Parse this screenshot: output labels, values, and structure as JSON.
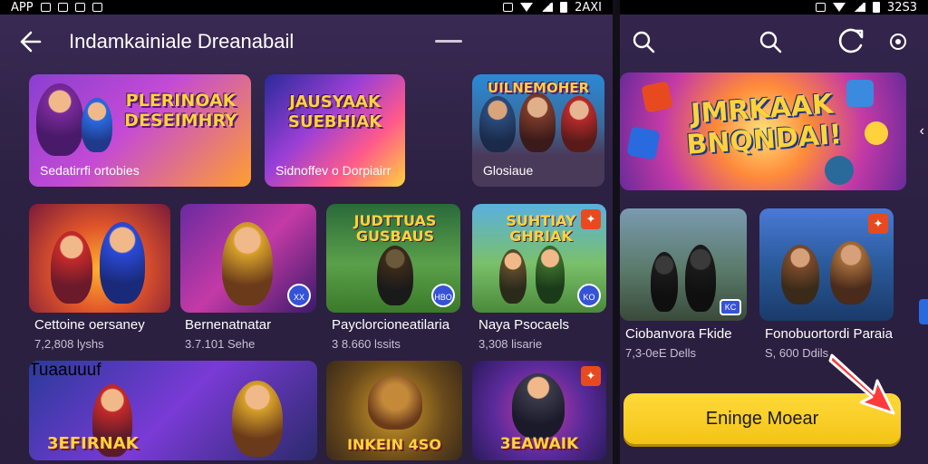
{
  "left_screen": {
    "status": {
      "left": "APP",
      "time": "2AXI"
    },
    "title": "Indamkainiale Dreanabail",
    "banners": [
      {
        "art_title": "PLERINOAK DESEIMHRY",
        "caption": "Sedatirrfi ortobies"
      },
      {
        "art_title": "JAUSYAAK SUEBHIAK",
        "caption": "Sidnoffev o Dorpiairr"
      },
      {
        "art_title": "UILNEMOHER",
        "caption": "Glosiaue"
      }
    ],
    "games": [
      {
        "art_title": "",
        "name": "Cettoine oersaney",
        "meta": "7,2,808 lyshs",
        "badge": ""
      },
      {
        "art_title": "",
        "name": "Bernenatnatar",
        "meta": "3.7.101 Sehe",
        "badge": "XX"
      },
      {
        "art_title": "JUDTTUAS GUSBAUS",
        "name": "Payclorcioneatilaria",
        "meta": "3 8.660 lssits",
        "badge": "HBO"
      },
      {
        "art_title": "SUHTIAY GHRIAK",
        "name": "Naya Psocaels",
        "meta": "3,308 lisarie",
        "badge": "KO"
      }
    ],
    "bottom_tiles": [
      {
        "top_title": "Tuaauuuf",
        "bottom_title": "3EFIRNAK"
      },
      {
        "top_title": "",
        "bottom_title": ""
      },
      {
        "top_title": "",
        "bottom_title": "INKEIN 4SO"
      },
      {
        "top_title": "",
        "bottom_title": "3EAWAIK"
      }
    ]
  },
  "right_screen": {
    "status": {
      "time": "32S3"
    },
    "banner_title": "JMRKAAK BNQNDAI!",
    "games": [
      {
        "name": "Ciobanvora Fkide",
        "meta": "7,3-0eE Dells",
        "badge": "KC"
      },
      {
        "name": "Fonobuortordi Paraia",
        "meta": "S, 600 Ddils",
        "badge": ""
      }
    ],
    "primary_button": "Eninge Moear"
  },
  "colors": {
    "accent": "#f3c416",
    "background": "#2c2142",
    "badge_red": "#e84a1f",
    "badge_blue": "#3553d6"
  },
  "icons": [
    "back-arrow-icon",
    "search-icon",
    "refresh-icon",
    "settings-icon",
    "chevron-left-icon",
    "pointer-arrow-icon"
  ]
}
